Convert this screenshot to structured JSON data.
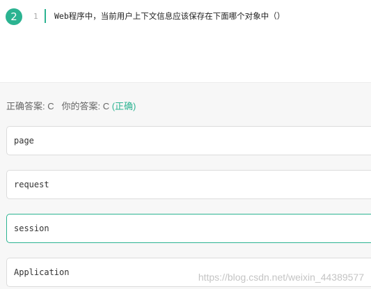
{
  "question": {
    "number": "2",
    "line_number": "1",
    "text": "Web程序中，当前用户上下文信息应该保存在下面哪个对象中（）"
  },
  "answer": {
    "correct_label": "正确答案: C",
    "your_label": "你的答案: C",
    "result": "(正确)"
  },
  "options": [
    {
      "text": "page"
    },
    {
      "text": "request"
    },
    {
      "text": "session"
    },
    {
      "text": "Application"
    }
  ],
  "selected_option_index": 2,
  "watermark": "https://blog.csdn.net/weixin_44389577",
  "colors": {
    "accent": "#2bb391",
    "panel_background": "#f7f7f7",
    "option_border": "#dcdcdc"
  }
}
